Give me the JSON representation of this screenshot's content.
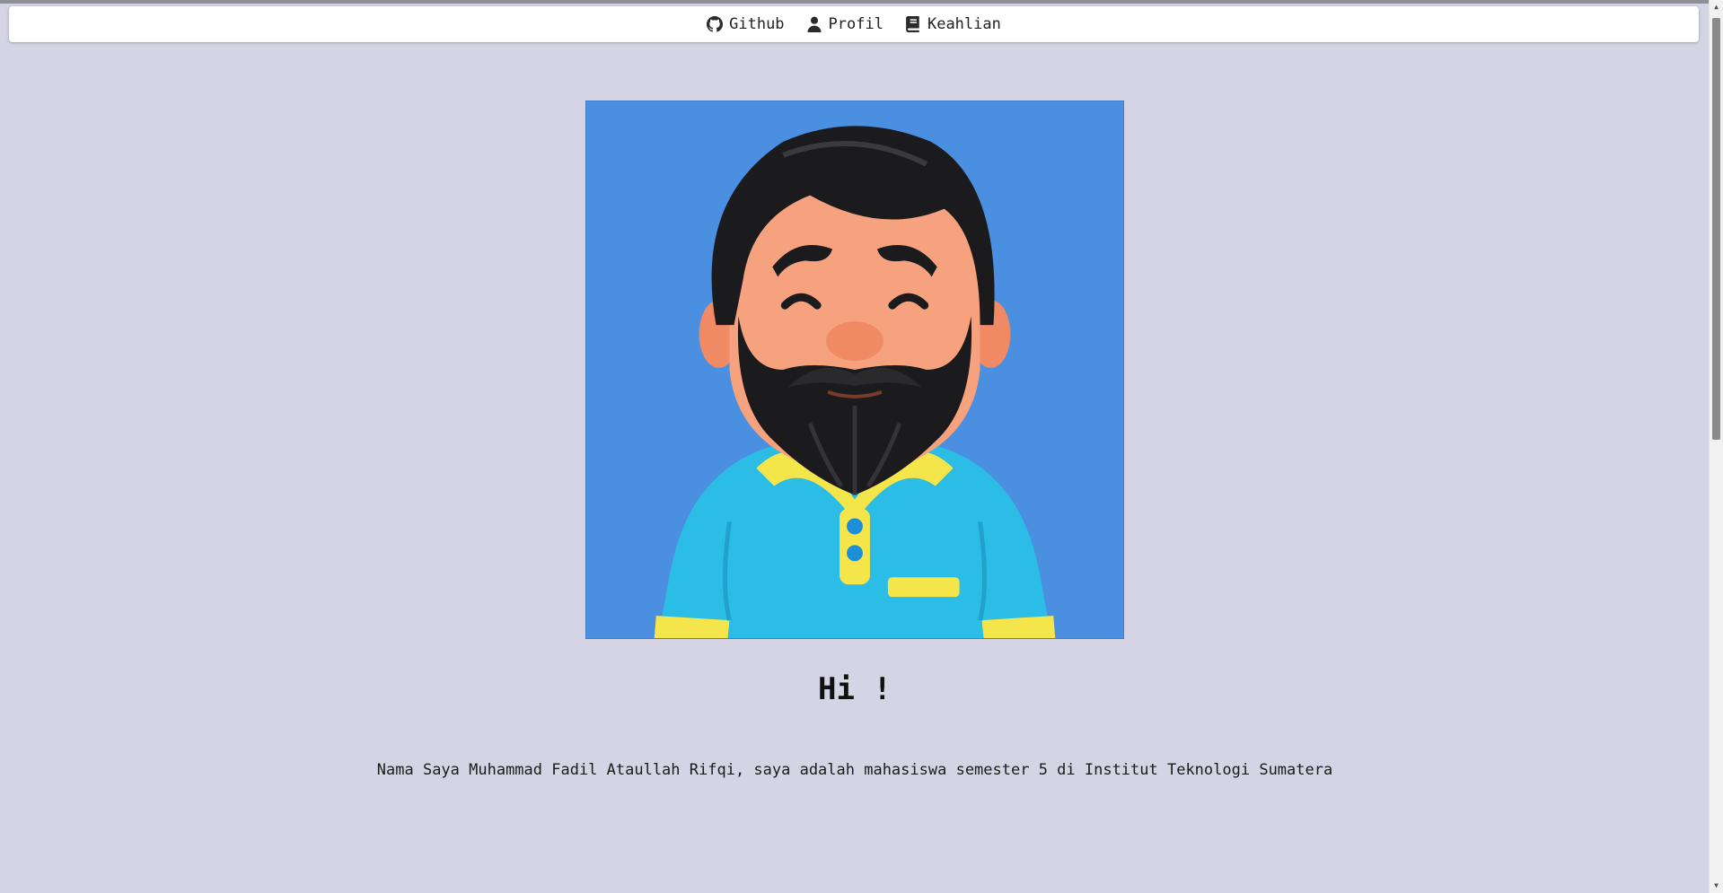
{
  "nav": {
    "items": [
      {
        "label": "Github",
        "icon": "github-icon"
      },
      {
        "label": "Profil",
        "icon": "user-icon"
      },
      {
        "label": "Keahlian",
        "icon": "book-icon"
      }
    ]
  },
  "profile": {
    "photo_alt": "avatar",
    "greeting": "Hi !",
    "intro": "Nama Saya Muhammad Fadil Ataullah Rifqi, saya adalah mahasiswa semester 5 di Institut Teknologi Sumatera"
  },
  "colors": {
    "page_bg": "#d4d4e4",
    "photo_bg": "#4a8fe0",
    "shirt": "#2bbde6",
    "collar": "#f4e54a"
  }
}
